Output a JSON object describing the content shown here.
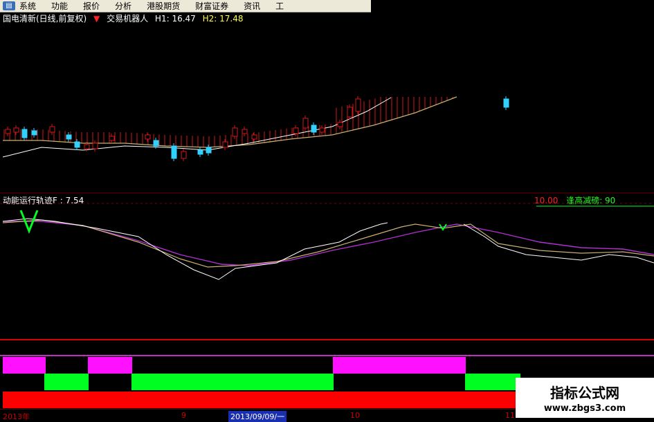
{
  "menu": {
    "items": [
      "系统",
      "功能",
      "报价",
      "分析",
      "港股期货",
      "财富证券",
      "资讯",
      "工"
    ]
  },
  "info": {
    "stock": "国电清新(日线,前复权)",
    "indicator": "交易机器人",
    "h1": "H1: 16.47",
    "h2": "H2: 17.48"
  },
  "indicator": {
    "label": "动能运行轨迹F : 7.54",
    "right_a": "10.00",
    "right_b": "逢高减磅: 90"
  },
  "axis": {
    "labels": [
      "2013年",
      "9",
      "2013/09/09/一",
      "10",
      "11"
    ]
  },
  "watermark": {
    "title": "指标公式网",
    "url": "www.zbgs3.com"
  },
  "colors": {
    "up": "#d01818",
    "down": "#30d0ff",
    "ma": "#c8b070",
    "pink": "#ff10ff",
    "green": "#00ff20",
    "red": "#ff0000",
    "white": "#ffffff",
    "purple": "#b030d0"
  }
}
